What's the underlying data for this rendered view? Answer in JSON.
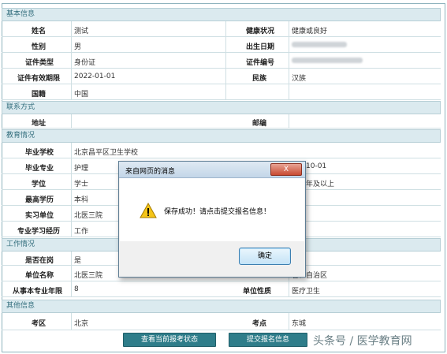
{
  "sections": {
    "basic": "基本信息",
    "contact": "联系方式",
    "education": "教育情况",
    "work": "工作情况",
    "other": "其他信息"
  },
  "basic": {
    "name_label": "姓名",
    "name_value": "测试",
    "health_label": "健康状况",
    "health_value": "健康或良好",
    "gender_label": "性别",
    "gender_value": "男",
    "birth_label": "出生日期",
    "idtype_label": "证件类型",
    "idtype_value": "身份证",
    "idno_label": "证件编号",
    "idvalid_label": "证件有效期限",
    "idvalid_value": "2022-01-01",
    "ethnic_label": "民族",
    "ethnic_value": "汉族",
    "nation_label": "国籍",
    "nation_value": "中国"
  },
  "contact": {
    "address_label": "地址",
    "postcode_label": "邮编"
  },
  "education": {
    "school_label": "毕业学校",
    "school_value": "北京昌平区卫生学校",
    "major_label": "毕业专业",
    "major_value": "护理",
    "grad_date_partial": "10-01",
    "degree_label": "学位",
    "degree_value": "学士",
    "degree_right_partial": "年及以上",
    "top_edu_label": "最高学历",
    "top_edu_value": "本科",
    "intern_label": "实习单位",
    "intern_value": "北医三院",
    "study_label": "专业学习经历",
    "study_value": "工作"
  },
  "work": {
    "onjob_label": "是否在岗",
    "onjob_value": "是",
    "unit_label": "单位名称",
    "unit_value": "北医三院",
    "unit_region_partial": "省、自治区",
    "years_label": "从事本专业年限",
    "years_value": "8",
    "unit_nature_label": "单位性质",
    "unit_nature_value": "医疗卫生"
  },
  "other": {
    "exam_area_label": "考区",
    "exam_area_value": "北京",
    "exam_site_label": "考点",
    "exam_site_value": "东城"
  },
  "buttons": {
    "status": "查看当前报考状态",
    "submit": "提交报名信息"
  },
  "watermark": "头条号 / 医学教育网",
  "dialog": {
    "title": "来自网页的消息",
    "close": "X",
    "message": "保存成功！请点击提交报名信息！",
    "ok": "确定"
  },
  "colors": {
    "section_bg": "#dbeaef",
    "section_text": "#36707f",
    "button_bg": "#2f7d8a"
  },
  "icons": [
    "warning-icon",
    "close-icon"
  ]
}
